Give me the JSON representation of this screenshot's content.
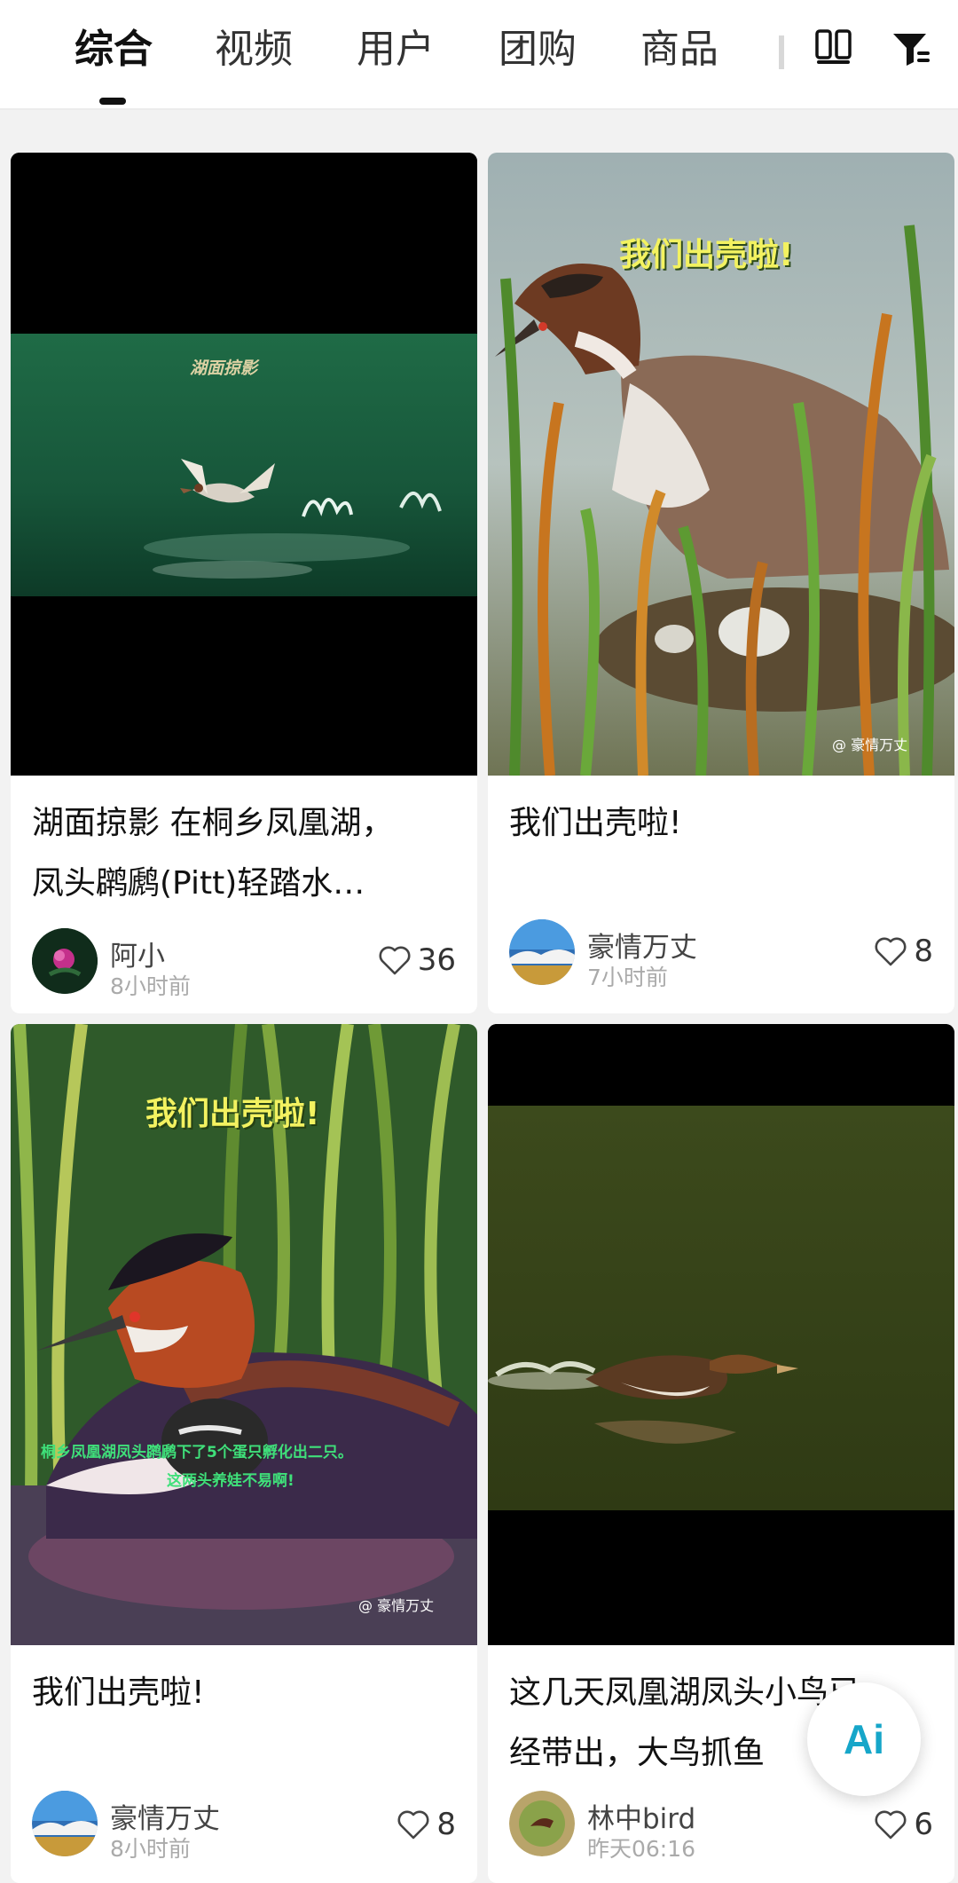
{
  "tabs": [
    "综合",
    "视频",
    "用户",
    "团购",
    "商品"
  ],
  "active_tab": 0,
  "icons": {
    "layout": "dual-column-layout-icon",
    "filter": "filter-icon",
    "like": "heart-outline-icon",
    "ai": "ai-assistant-icon"
  },
  "cards": [
    {
      "overlay_text": "湖面掠影",
      "title_lines": [
        "湖面掠影 在桐乡凤凰湖，",
        "凤头䴙䴘(Pitt)轻踏水…"
      ],
      "author": "阿小",
      "time": "8小时前",
      "likes": "36"
    },
    {
      "overlay_text": "我们出壳啦!",
      "watermark": "@ 豪情万丈",
      "title_lines": [
        "我们出壳啦!"
      ],
      "author": "豪情万丈",
      "time": "7小时前",
      "likes": "8"
    },
    {
      "overlay_text": "我们出壳啦!",
      "overlay_sub1": "桐乡凤凰湖凤头䴙䴘下了5个蛋只孵化出二只。",
      "overlay_sub2": "这两头养娃不易啊!",
      "watermark": "@ 豪情万丈",
      "title_lines": [
        "我们出壳啦!"
      ],
      "author": "豪情万丈",
      "time": "8小时前",
      "likes": "8"
    },
    {
      "title_lines": [
        "这几天凤凰湖凤头小鸟已",
        "经带出，大鸟抓鱼"
      ],
      "author": "林中bird",
      "time": "昨天06:16",
      "likes": "6"
    }
  ],
  "ai_button_label": "Ai"
}
